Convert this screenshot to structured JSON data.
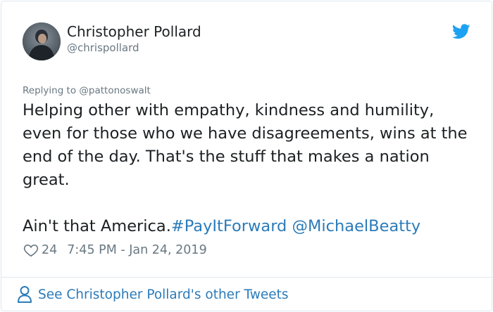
{
  "user": {
    "display_name": "Christopher Pollard",
    "handle": "@chrispollard",
    "avatar_icon": "profile-photo"
  },
  "reply": {
    "prefix": "Replying to ",
    "mention": "@pattonoswalt"
  },
  "tweet": {
    "paragraph1": "Helping other with empathy, kindness and humility, even for those who we have disagreements, wins at the end of the day. That's the stuff that makes a nation great.",
    "paragraph2_text": "Ain't that America.",
    "hashtag": "#PayItForward",
    "mention": "@MichaelBeatty"
  },
  "meta": {
    "likes": "24",
    "timestamp": "7:45 PM - Jan 24, 2019",
    "like_icon": "heart-icon"
  },
  "footer": {
    "link_text": "See Christopher Pollard's other Tweets",
    "icon": "person-icon"
  },
  "colors": {
    "link": "#2b7bb9",
    "muted": "#697882",
    "text": "#1c2022",
    "twitter_blue": "#1da1f2",
    "border": "#e1e8ed"
  }
}
